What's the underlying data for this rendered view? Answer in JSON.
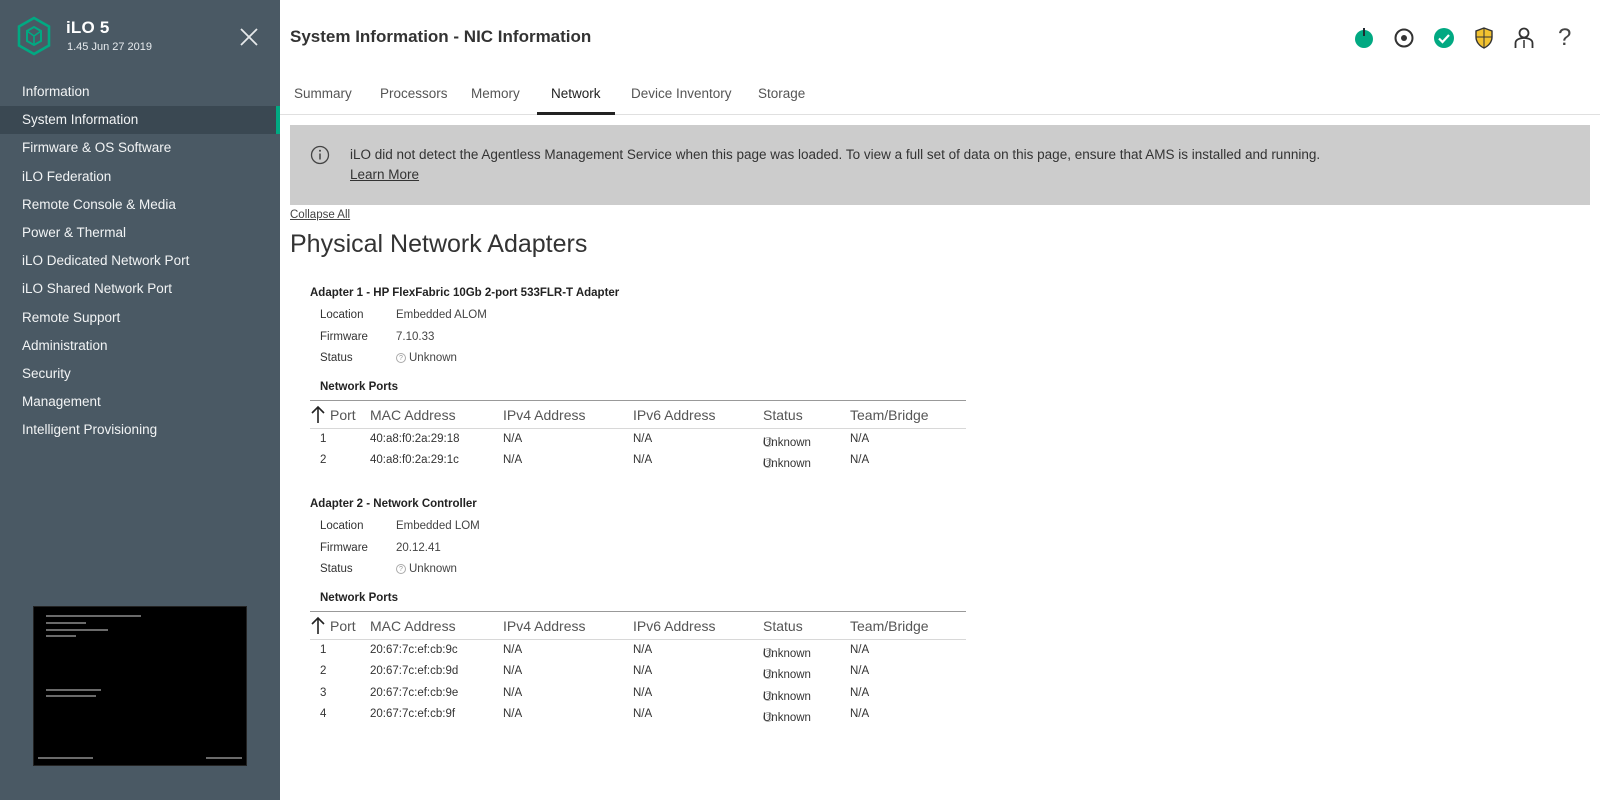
{
  "app": {
    "name": "iLO 5",
    "version": "1.45 Jun 27 2019",
    "accent": "#01a982"
  },
  "sidebar": {
    "items": [
      {
        "label": "Information",
        "active": false
      },
      {
        "label": "System Information",
        "active": true
      },
      {
        "label": "Firmware & OS Software",
        "active": false
      },
      {
        "label": "iLO Federation",
        "active": false
      },
      {
        "label": "Remote Console & Media",
        "active": false
      },
      {
        "label": "Power & Thermal",
        "active": false
      },
      {
        "label": "iLO Dedicated Network Port",
        "active": false
      },
      {
        "label": "iLO Shared Network Port",
        "active": false
      },
      {
        "label": "Remote Support",
        "active": false
      },
      {
        "label": "Administration",
        "active": false
      },
      {
        "label": "Security",
        "active": false
      },
      {
        "label": "Management",
        "active": false
      },
      {
        "label": "Intelligent Provisioning",
        "active": false
      }
    ]
  },
  "header": {
    "title": "System Information - NIC Information",
    "icons": [
      "power-icon",
      "locate-icon",
      "health-ok-icon",
      "security-shield-icon",
      "user-icon",
      "help-icon"
    ],
    "help_glyph": "?"
  },
  "tabs": [
    {
      "label": "Summary",
      "active": false
    },
    {
      "label": "Processors",
      "active": false
    },
    {
      "label": "Memory",
      "active": false
    },
    {
      "label": "Network",
      "active": true
    },
    {
      "label": "Device Inventory",
      "active": false
    },
    {
      "label": "Storage",
      "active": false
    }
  ],
  "banner": {
    "message": "iLO did not detect the Agentless Management Service when this page was loaded. To view a full set of data on this page, ensure that AMS is installed and running.",
    "link": "Learn More"
  },
  "collapse_all": "Collapse All",
  "section_title": "Physical Network Adapters",
  "labels": {
    "location": "Location",
    "firmware": "Firmware",
    "status": "Status",
    "network_ports": "Network Ports"
  },
  "table_headers": [
    "Port",
    "MAC Address",
    "IPv4 Address",
    "IPv6 Address",
    "Status",
    "Team/Bridge"
  ],
  "adapters": [
    {
      "title": "Adapter 1 - HP FlexFabric 10Gb 2-port 533FLR-T Adapter",
      "location": "Embedded ALOM",
      "firmware": "7.10.33",
      "status": "Unknown",
      "ports": [
        {
          "port": "1",
          "mac": "40:a8:f0:2a:29:18",
          "ipv4": "N/A",
          "ipv6": "N/A",
          "status": "Unknown",
          "team": "N/A"
        },
        {
          "port": "2",
          "mac": "40:a8:f0:2a:29:1c",
          "ipv4": "N/A",
          "ipv6": "N/A",
          "status": "Unknown",
          "team": "N/A"
        }
      ]
    },
    {
      "title": "Adapter 2 - Network Controller",
      "location": "Embedded LOM",
      "firmware": "20.12.41",
      "status": "Unknown",
      "ports": [
        {
          "port": "1",
          "mac": "20:67:7c:ef:cb:9c",
          "ipv4": "N/A",
          "ipv6": "N/A",
          "status": "Unknown",
          "team": "N/A"
        },
        {
          "port": "2",
          "mac": "20:67:7c:ef:cb:9d",
          "ipv4": "N/A",
          "ipv6": "N/A",
          "status": "Unknown",
          "team": "N/A"
        },
        {
          "port": "3",
          "mac": "20:67:7c:ef:cb:9e",
          "ipv4": "N/A",
          "ipv6": "N/A",
          "status": "Unknown",
          "team": "N/A"
        },
        {
          "port": "4",
          "mac": "20:67:7c:ef:cb:9f",
          "ipv4": "N/A",
          "ipv6": "N/A",
          "status": "Unknown",
          "team": "N/A"
        }
      ]
    }
  ]
}
